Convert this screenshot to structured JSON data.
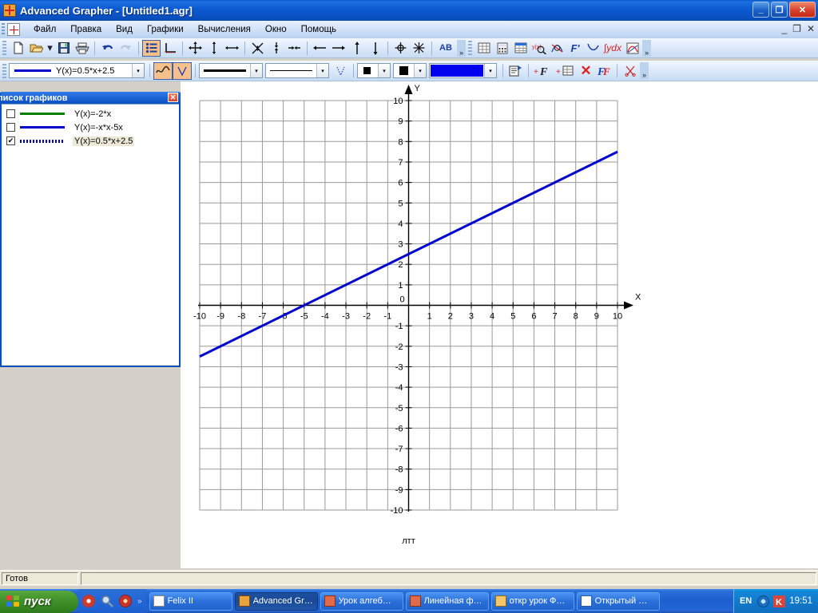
{
  "window": {
    "title": "Advanced Grapher  - [Untitled1.agr]",
    "app_icon": "grapher-icon",
    "minimize": "_",
    "maximize": "❐",
    "close": "✕"
  },
  "menu": {
    "items": [
      {
        "label": "Файл"
      },
      {
        "label": "Правка"
      },
      {
        "label": "Вид"
      },
      {
        "label": "Графики"
      },
      {
        "label": "Вычисления"
      },
      {
        "label": "Окно"
      },
      {
        "label": "Помощь"
      }
    ],
    "mdi_minimize": "_",
    "mdi_restore": "❐",
    "mdi_close": "✕"
  },
  "toolbar_main": {
    "buttons": [
      {
        "name": "new-document-icon",
        "glyph": "\u0001"
      },
      {
        "name": "open-folder-icon",
        "glyph": "\u0002"
      },
      {
        "name": "open-dropdown-icon",
        "glyph": "▾"
      },
      {
        "name": "save-icon",
        "glyph": "\u0003"
      },
      {
        "name": "print-icon",
        "glyph": "\u0004"
      },
      {
        "name": "undo-icon",
        "glyph": "↶"
      },
      {
        "name": "redo-icon",
        "glyph": "↷"
      },
      {
        "name": "graph-list-icon",
        "glyph": "☰",
        "active": true
      },
      {
        "name": "axes-properties-icon",
        "glyph": "└"
      },
      {
        "name": "pan-icon",
        "glyph": "✤"
      },
      {
        "name": "zoom-vertical-icon",
        "glyph": "↕"
      },
      {
        "name": "zoom-horizontal-icon",
        "glyph": "↔"
      },
      {
        "name": "zoom-in-icon",
        "glyph": "✵"
      },
      {
        "name": "zoom-out-vertical-icon",
        "glyph": "⇳"
      },
      {
        "name": "zoom-out-horizontal-icon",
        "glyph": "⇥"
      },
      {
        "name": "scroll-left-icon",
        "glyph": "←"
      },
      {
        "name": "scroll-right-icon",
        "glyph": "→"
      },
      {
        "name": "scroll-up-icon",
        "glyph": "↑"
      },
      {
        "name": "scroll-down-icon",
        "glyph": "↓"
      },
      {
        "name": "center-origin-icon",
        "glyph": "⊕"
      },
      {
        "name": "fit-view-icon",
        "glyph": "✳"
      },
      {
        "name": "text-label-icon",
        "glyph": "AB"
      },
      {
        "name": "table-icon",
        "glyph": "☷"
      },
      {
        "name": "calculator-icon",
        "glyph": "⌸"
      },
      {
        "name": "spreadsheet-icon",
        "glyph": "▦"
      },
      {
        "name": "find-value-icon",
        "glyph": "y(x)"
      },
      {
        "name": "intersections-icon",
        "glyph": "⨯"
      },
      {
        "name": "derivative-icon",
        "glyph": "F'"
      },
      {
        "name": "tangent-icon",
        "glyph": "╲"
      },
      {
        "name": "integral-icon",
        "glyph": "∫ydx"
      },
      {
        "name": "regression-icon",
        "glyph": "◠"
      }
    ],
    "overflow": "»"
  },
  "toolbar_graph": {
    "function_combo": {
      "value": "Y(x)=0.5*x+2.5",
      "line_color": "#0000cc",
      "dropdown_arrow": "▾"
    },
    "mode_buttons": [
      {
        "name": "function-mode-icon",
        "glyph": "∿",
        "active": true
      },
      {
        "name": "style-mode-icon",
        "glyph": "V",
        "active": true
      }
    ],
    "line_width_combo": {
      "name": "line-width-combo",
      "arrow": "▾"
    },
    "line_style_combo": {
      "name": "line-style-combo",
      "arrow": "▾"
    },
    "dotted-preview": "V",
    "marker_combo": {
      "name": "marker-style-combo",
      "arrow": "▾"
    },
    "point_combo": {
      "name": "point-size-combo",
      "arrow": "▾"
    },
    "color_combo": {
      "name": "line-color-combo",
      "color": "#0000ee",
      "arrow": "▾"
    },
    "buttons": [
      {
        "name": "graph-properties-icon",
        "glyph": "✐"
      },
      {
        "name": "add-function-icon",
        "glyph": "+F"
      },
      {
        "name": "add-table-icon",
        "glyph": "+▦"
      },
      {
        "name": "delete-graph-icon",
        "glyph": "✕"
      },
      {
        "name": "edit-function-icon",
        "glyph": "F"
      },
      {
        "name": "cut-graph-icon",
        "glyph": "✂"
      }
    ],
    "overflow": "»"
  },
  "graph_list_panel": {
    "title": "писок графиков",
    "close_label": "✕",
    "rows": [
      {
        "checked": false,
        "check_glyph": "",
        "color": "#008000",
        "style": "solid",
        "label": "Y(x)=-2*x",
        "selected": false
      },
      {
        "checked": false,
        "check_glyph": "",
        "color": "#0000cc",
        "style": "solid",
        "label": "Y(x)=-x*x-5x",
        "selected": false
      },
      {
        "checked": true,
        "check_glyph": "✔",
        "color": "#0000cc",
        "style": "dotted",
        "label": "Y(x)=0.5*x+2.5",
        "selected": true
      }
    ]
  },
  "chart_data": {
    "type": "line",
    "title": "",
    "caption": "лтт",
    "xlabel": "X",
    "ylabel": "Y",
    "xlim": [
      -10,
      10
    ],
    "ylim": [
      -10,
      10
    ],
    "grid": true,
    "x_ticks": [
      -10,
      -9,
      -8,
      -7,
      -6,
      -5,
      -4,
      -3,
      -2,
      -1,
      0,
      1,
      2,
      3,
      4,
      5,
      6,
      7,
      8,
      9,
      10
    ],
    "y_ticks": [
      10,
      9,
      8,
      7,
      6,
      5,
      4,
      3,
      2,
      1,
      -1,
      -2,
      -3,
      -4,
      -5,
      -6,
      -7,
      -8,
      -9,
      -10
    ],
    "y_origin_label": "0",
    "series": [
      {
        "name": "Y(x)=0.5*x+2.5",
        "color": "#0000cc",
        "width": 3,
        "expression": "Y(x)=0.5*x+2.5",
        "slope": 0.5,
        "intercept": 2.5,
        "x": [
          -10,
          10
        ],
        "values": [
          -2.5,
          7.5
        ]
      }
    ],
    "legend": "none"
  },
  "statusbar": {
    "message": "Готов",
    "secondary": ""
  },
  "taskbar": {
    "start_label": "пуск",
    "quicklaunch": [
      {
        "name": "media-player-icon"
      },
      {
        "name": "search-icon"
      },
      {
        "name": "opera-icon"
      }
    ],
    "quick_more": "»",
    "tasks": [
      {
        "label": "Felix II",
        "icon": "cards-icon",
        "active": false
      },
      {
        "label": "Advanced Gr…",
        "icon": "grapher-icon",
        "active": true
      },
      {
        "label": "Урок алгеб…",
        "icon": "powerpoint-icon",
        "active": false
      },
      {
        "label": "Линейная ф…",
        "icon": "powerpoint-icon",
        "active": false
      },
      {
        "label": "откр урок Ф…",
        "icon": "folder-icon",
        "active": false
      },
      {
        "label": "Открытый …",
        "icon": "word-icon",
        "active": false
      }
    ],
    "language": "EN",
    "tray": [
      {
        "name": "volume-icon"
      },
      {
        "name": "kaspersky-icon"
      }
    ],
    "clock": "19:51"
  }
}
